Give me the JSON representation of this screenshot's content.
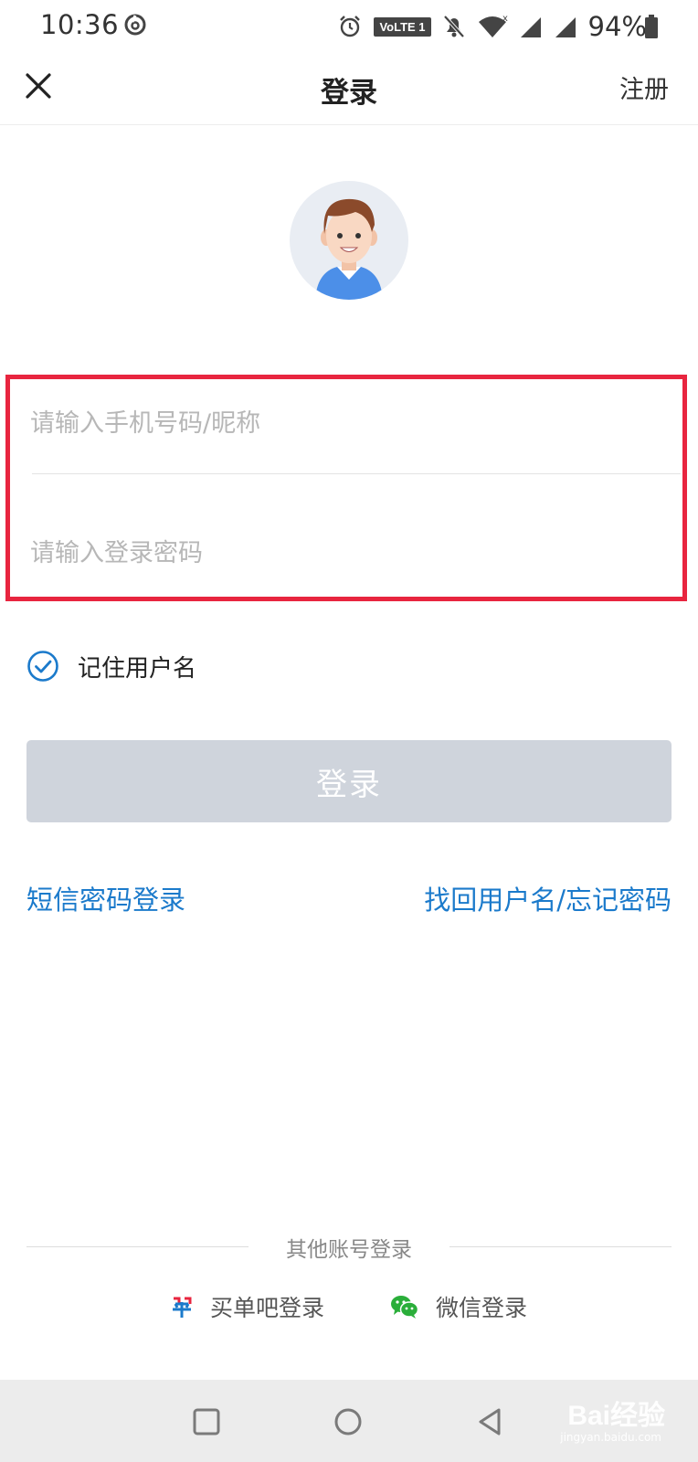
{
  "status_bar": {
    "time": "10:36",
    "network_badge": "VoLTE 1",
    "battery": "94%",
    "icons": [
      "netease-music-icon",
      "alarm-icon",
      "notifications-off-icon",
      "wifi-icon",
      "signal-icon",
      "battery-icon"
    ]
  },
  "header": {
    "close_icon": "close-icon",
    "title": "登录",
    "register_label": "注册"
  },
  "form": {
    "phone_placeholder": "请输入手机号码/昵称",
    "phone_value": "",
    "password_placeholder": "请输入登录密码",
    "password_value": ""
  },
  "remember": {
    "label": "记住用户名",
    "checked": true
  },
  "login_button": {
    "label": "登录"
  },
  "links": {
    "sms_login": "短信密码登录",
    "forgot": "找回用户名/忘记密码"
  },
  "other_login": {
    "title": "其他账号登录",
    "options": [
      {
        "label": "买单吧登录",
        "icon": "maidanba-icon"
      },
      {
        "label": "微信登录",
        "icon": "wechat-icon"
      }
    ]
  },
  "nav_bar": {
    "buttons": [
      "recents-button",
      "home-button",
      "back-button"
    ]
  },
  "watermark": {
    "text": "Bai经验",
    "sub": "jingyan.baidu.com"
  },
  "colors": {
    "link": "#1b7acb",
    "highlight_border": "#e8253f",
    "button_disabled": "#cfd4dc"
  }
}
